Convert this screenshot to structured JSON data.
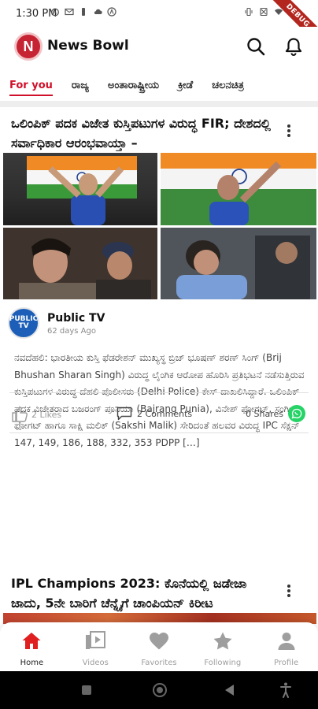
{
  "status_bar": {
    "time": "1:30 PM",
    "debug_label": "DEBUG"
  },
  "app": {
    "logo_letter": "N",
    "title": "News Bowl"
  },
  "tabs": [
    {
      "label": "For you",
      "active": true
    },
    {
      "label": "ರಾಜ್ಯ",
      "active": false
    },
    {
      "label": "ಅಂತಾರಾಷ್ಟ್ರೀಯ",
      "active": false
    },
    {
      "label": "ಕ್ರೀಡೆ",
      "active": false
    },
    {
      "label": "ಚಲನಚಿತ್ರ",
      "active": false
    }
  ],
  "article": {
    "headline": "ಒಲಿಂಪಿಕ್ ಪದಕ ವಿಜೇತ ಕುಸ್ತಿಪಟುಗಳ ವಿರುದ್ಧ FIR; ದೇಶದಲ್ಲಿ ಸರ್ವಾಧಿಕಾರ ಆರಂಭವಾಯ್ತಾ –",
    "source": {
      "logo_text": "PUBLIC TV",
      "name": "Public TV",
      "time": "62 days Ago"
    },
    "summary": "ನವದೆಹಲಿ: ಭಾರತೀಯ ಕುಸ್ತಿ ಫೆಡರೇಶನ್ ಮುಖ್ಯಸ್ಥ ಬ್ರಿಜ್ ಭೂಷಣ್ ಶರಣ್ ಸಿಂಗ್ (Brij Bhushan Sharan Singh) ವಿರುದ್ಧ ಲೈಂಗಿಕ ಆರೋಪ ಹೊರಿಸಿ ಪ್ರತಿಭಟನೆ ನಡೆಸುತ್ತಿರುವ ಕುಸ್ತಿಪಟುಗಳ ವಿರುದ್ಧ ದೆಹಲಿ ಪೊಲೀಸರು (Delhi Police) ಕೇಸ್ ದಾಖಲಿಸಿದ್ದಾರೆ. ಒಲಿಂಪಿಕ್ ಪದಕ ವಿಜೇತರಾದ ಬಜರಂಗ್ ಪೂನಿಯಾ (Bajrang Punia), ವಿನೇಶ್ ಫೋಗಟ್, ಸಂಗೀತಾ ಫೋಗಟ್ ಹಾಗೂ ಸಾಕ್ಷಿ ಮಲಿಕ್ (Sakshi Malik) ಸೇರಿದಂತೆ ಹಲವರ ವಿರುದ್ಧ IPC ಸೆಕ್ಷನ್ 147, 149, 186, 188, 332, 353 PDPP […]",
    "likes": "2 Likes",
    "comments": "2 Comments",
    "shares": "0 Shares"
  },
  "article2": {
    "headline": "IPL Champions 2023: ಕೊನೆಯಲ್ಲಿ ಜಡೇಜಾ ಜಾದು, 5ನೇ ಬಾರಿಗೆ ಚೆನ್ನೈಗೆ ಚಾಂಪಿಯನ್ ಕಿರೀಟ"
  },
  "bottom_nav": [
    {
      "label": "Home",
      "icon": "home-icon",
      "active": true
    },
    {
      "label": "Videos",
      "icon": "video-icon",
      "active": false
    },
    {
      "label": "Favorites",
      "icon": "heart-icon",
      "active": false
    },
    {
      "label": "Following",
      "icon": "star-icon",
      "active": false
    },
    {
      "label": "Profile",
      "icon": "person-icon",
      "active": false
    }
  ],
  "colors": {
    "accent": "#d0102a",
    "nav_active": "#e02020",
    "nav_inactive": "#9e9e9e",
    "whatsapp": "#25d366",
    "source_logo_bg": "#1d5fb8"
  }
}
